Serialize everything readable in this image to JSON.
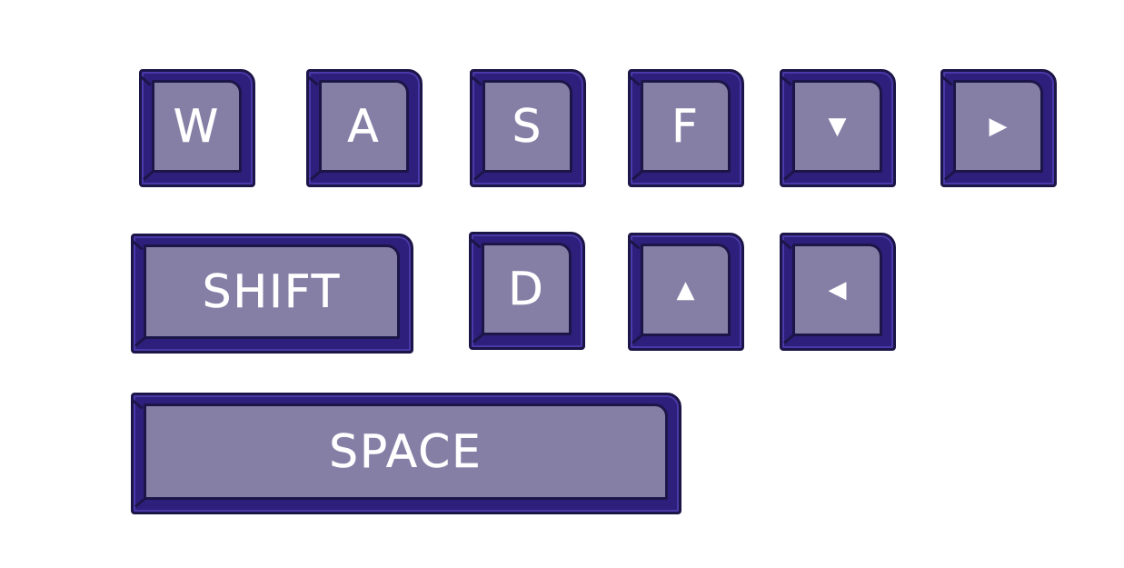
{
  "keys": {
    "w": "W",
    "a": "A",
    "s": "S",
    "f": "F",
    "down": "▼",
    "right": "▶",
    "shift": "SHIFT",
    "d": "D",
    "up": "▲",
    "left": "◀",
    "space": "SPACE"
  },
  "colors": {
    "key_face": "#857fa6",
    "key_base": "#2e1f7c",
    "outline": "#1c1548",
    "label": "#ffffff"
  }
}
